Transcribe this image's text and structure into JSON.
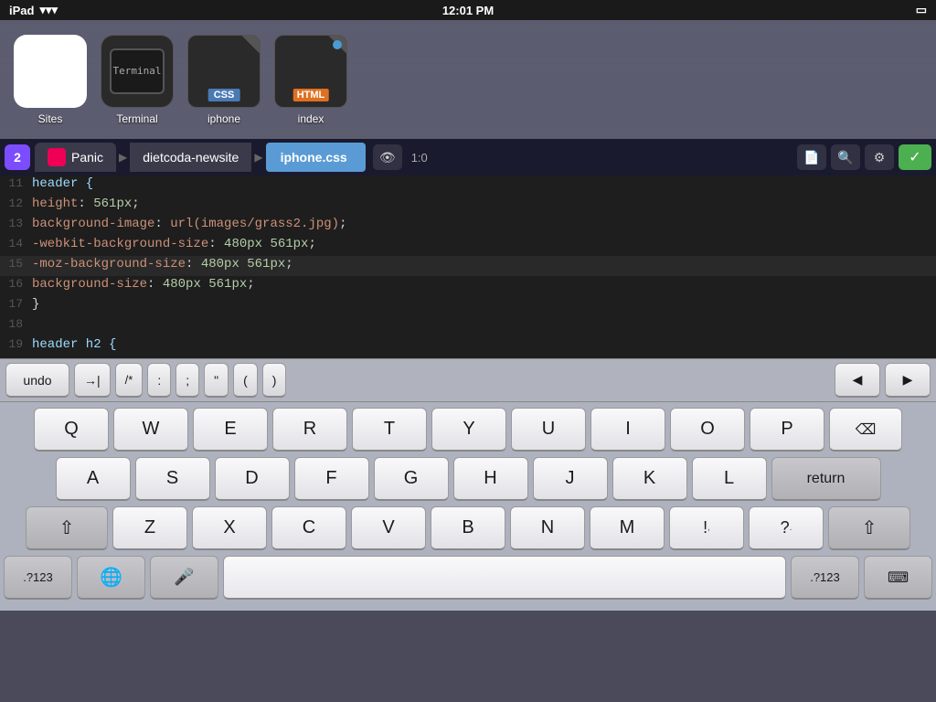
{
  "statusBar": {
    "device": "iPad",
    "wifi": "WiFi",
    "time": "12:01 PM",
    "battery": "Battery"
  },
  "dock": {
    "items": [
      {
        "id": "sites",
        "label": "Sites",
        "type": "sites"
      },
      {
        "id": "terminal",
        "label": "Terminal",
        "type": "terminal"
      },
      {
        "id": "iphone-css",
        "label": "iphone",
        "type": "css"
      },
      {
        "id": "index-html",
        "label": "index",
        "type": "html"
      }
    ]
  },
  "tabBar": {
    "badge": "2",
    "tabs": [
      {
        "id": "panic",
        "label": "Panic",
        "type": "root"
      },
      {
        "id": "dietcoda",
        "label": "dietcoda-newsite",
        "type": "folder"
      },
      {
        "id": "iphonecss",
        "label": "iphone.css",
        "type": "active"
      }
    ],
    "eyeIcon": "👁",
    "position": "1:0",
    "settingsIcon": "⚙",
    "searchIcon": "🔍",
    "fileIcon": "📄",
    "checkIcon": "✓"
  },
  "codeEditor": {
    "lines": [
      {
        "num": "11",
        "content": "header {",
        "type": "selector"
      },
      {
        "num": "12",
        "content": "    height: 561px;",
        "type": "prop-val"
      },
      {
        "num": "13",
        "content": "    background-image: url(images/grass2.jpg);",
        "type": "bg-image"
      },
      {
        "num": "14",
        "content": "    -webkit-background-size: 480px 561px;",
        "type": "prop-val"
      },
      {
        "num": "15",
        "content": "    -moz-background-size: 480px 561px;",
        "type": "prop-val"
      },
      {
        "num": "16",
        "content": "    background-size: 480px 561px;",
        "type": "prop-val"
      },
      {
        "num": "17",
        "content": "}",
        "type": "brace"
      },
      {
        "num": "18",
        "content": "",
        "type": "empty"
      },
      {
        "num": "19",
        "content": "header h2 {",
        "type": "selector"
      }
    ]
  },
  "keyboardToolbar": {
    "undo": "undo",
    "tab": "→|",
    "comment": "/*",
    "colon": ":",
    "semicolon": ";",
    "quote": "\"",
    "openParen": "(",
    "closeParen": ")",
    "arrowLeft": "◀",
    "arrowRight": "▶"
  },
  "keyboard": {
    "row1": [
      "Q",
      "W",
      "E",
      "R",
      "T",
      "Y",
      "U",
      "I",
      "O",
      "P"
    ],
    "row2": [
      "A",
      "S",
      "D",
      "F",
      "G",
      "H",
      "J",
      "K",
      "L"
    ],
    "row3": [
      "Z",
      "X",
      "C",
      "V",
      "B",
      "N",
      "M",
      "!,",
      "?."
    ],
    "specialKeys": {
      "backspace": "⌫",
      "return": "return",
      "shiftLeft": "⇧",
      "shiftRight": "⇧",
      "numbers": ".?123",
      "globe": "🌐",
      "mic": "🎤",
      "space": "",
      "hideKeyboard": "⌨"
    }
  }
}
